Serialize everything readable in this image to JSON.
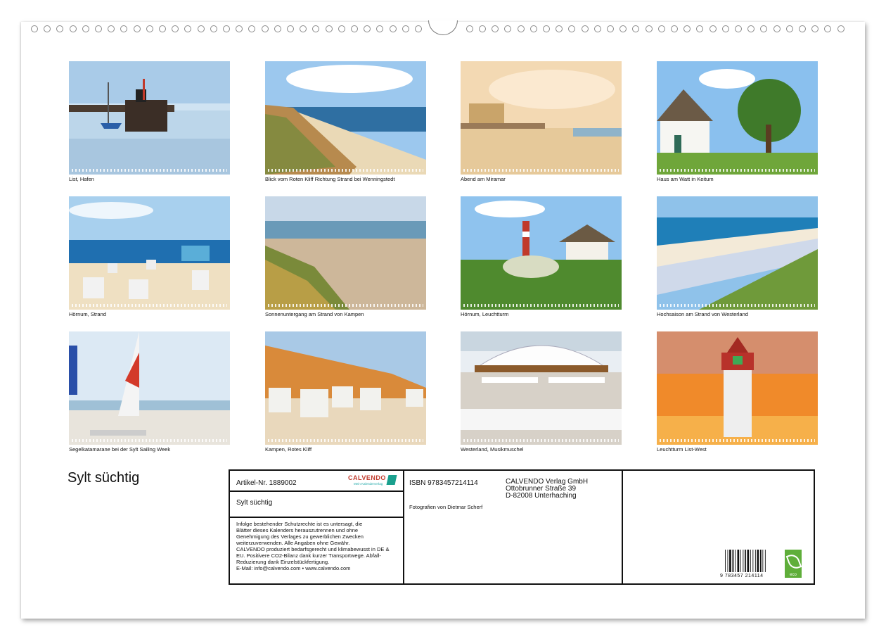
{
  "calendar": {
    "title": "Sylt süchtig",
    "photos": [
      {
        "caption": "List, Hafen",
        "scene": "harbor"
      },
      {
        "caption": "Blick vom Roten Kliff Richtung Strand bei Wenningstedt",
        "scene": "cliff-beach"
      },
      {
        "caption": "Abend am Miramar",
        "scene": "evening-beach"
      },
      {
        "caption": "Haus am Watt in Keitum",
        "scene": "thatched-house"
      },
      {
        "caption": "Hörnum, Strand",
        "scene": "beach-chairs"
      },
      {
        "caption": "Sonnenuntergang am Strand von Kampen",
        "scene": "sunset-beach"
      },
      {
        "caption": "Hörnum, Leuchtturm",
        "scene": "lighthouse-village"
      },
      {
        "caption": "Hochsaison am Strand von Westerland",
        "scene": "busy-beach"
      },
      {
        "caption": "Segelkatamarane bei der Sylt Sailing Week",
        "scene": "catamarans"
      },
      {
        "caption": "Kampen, Rotes Kliff",
        "scene": "red-cliff"
      },
      {
        "caption": "Westerland, Musikmuschel",
        "scene": "bandshell"
      },
      {
        "caption": "Leuchtturm List-West",
        "scene": "lighthouse-sunset"
      }
    ]
  },
  "imprint": {
    "article": "Artikel-Nr. 1889002",
    "logo_word": "CALVENDO",
    "logo_sub": "Mein Kalenderverlag",
    "title": "Sylt süchtig",
    "legal": [
      "Infolge bestehender Schutzrechte ist es untersagt, die",
      "Blätter dieses Kalenders herauszutrennen und ohne",
      "Genehmigung des Verlages zu gewerblichen Zwecken",
      "weiterzuverwenden. Alle Angaben ohne Gewähr.",
      "CALVENDO produziert bedarfsgerecht und klimabewusst in DE &",
      "EU. Positivere CO2-Bilanz dank kurzer Transportwege. Abfall-",
      "Reduzierung dank Einzelstückfertigung.",
      "E-Mail: info@calvendo.com • www.calvendo.com"
    ],
    "isbn": "ISBN 9783457214114",
    "photographer": "Fotografien von Dietmar Scherf",
    "publisher": [
      "CALVENDO Verlag GmbH",
      "Ottobrunner Straße 39",
      "D-82008 Unterhaching"
    ],
    "barcode_number": "9 783457 214114",
    "eco_label": "eco"
  },
  "colors": {
    "sky": "#8ec3ea",
    "sea": "#2a6fa8",
    "sand": "#e8d6b4",
    "grass": "#5a8a2c",
    "sunset": "#f08a2a"
  }
}
